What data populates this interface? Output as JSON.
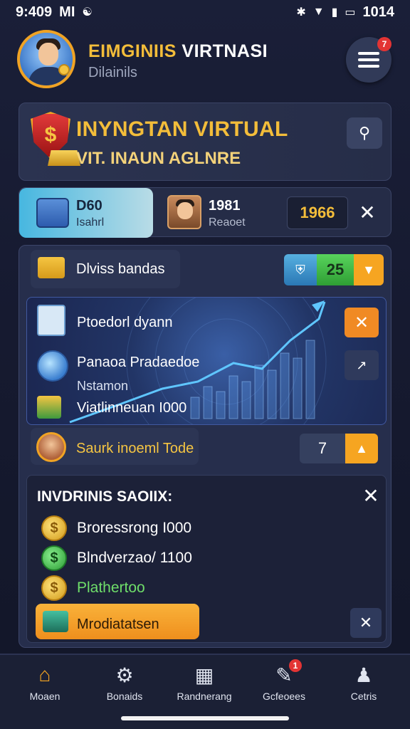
{
  "status_bar": {
    "time": "9:409",
    "carrier": "MI",
    "battery": "1014"
  },
  "header": {
    "title_gold": "EIMGINIIS",
    "title_white": "VIRTNASI",
    "subtitle": "Dilainils",
    "menu_badge": "7"
  },
  "hero": {
    "shield_symbol": "$",
    "title": "INYNGTAN VIRTUAL",
    "subtitle": "VIT. INAUN AGLNRE"
  },
  "tabs": {
    "tab1": {
      "value": "D60",
      "label": "Isahrl"
    },
    "tab2": {
      "value": "1981",
      "label": "Reaoet"
    },
    "counter": "1966"
  },
  "panel": {
    "row1_label": "Dlviss bandas",
    "row1_count": "25",
    "chart_card": {
      "line1": "Ptoedorl dyann",
      "line2": "Panaoa Pradaedoe",
      "line3": "Nstamon",
      "line4": "Viatlinneuan I000"
    },
    "row3_label": "Saurk inoeml Tode",
    "row3_number": "7",
    "list": {
      "title": "INVDRINIS SAOIIX:",
      "items": [
        {
          "icon": "gold-coin-icon",
          "label": "Broressrong I000"
        },
        {
          "icon": "green-coin-icon",
          "label": "Blndverzao/ 1100"
        },
        {
          "icon": "gold-coin-icon",
          "label": "Plathertoo"
        }
      ],
      "action_label": "Mrodiatatsen"
    }
  },
  "bottom_nav": [
    {
      "label": "Moaen"
    },
    {
      "label": "Bonaids"
    },
    {
      "label": "Randnerang"
    },
    {
      "label": "Gcfeoees"
    },
    {
      "label": "Cetris"
    }
  ],
  "bottom_nav_badge": "1",
  "colors": {
    "accent_gold": "#f3bd3a",
    "accent_orange": "#f6a521",
    "active_tab": "#47b7e0"
  }
}
